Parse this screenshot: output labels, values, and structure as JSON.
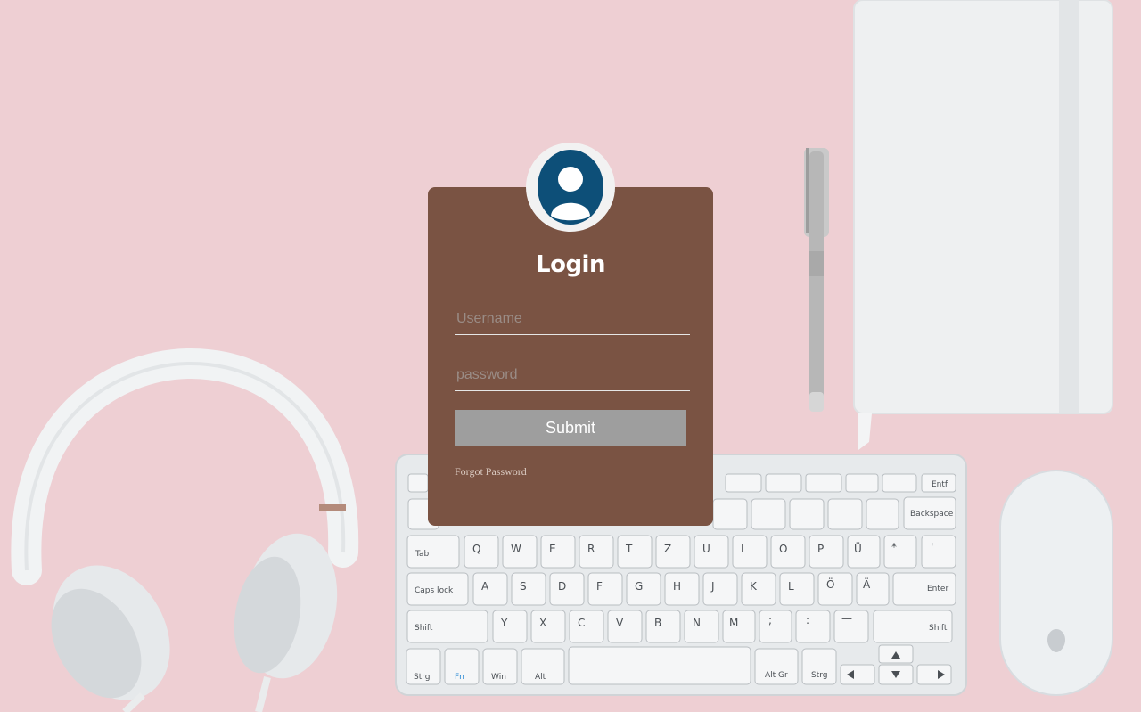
{
  "login": {
    "title": "Login",
    "username_placeholder": "Username",
    "password_placeholder": "password",
    "submit_label": "Submit",
    "forgot_label": "Forgot Password"
  },
  "keyboard": {
    "row1": [
      "Entf"
    ],
    "row2": [
      "Backspace"
    ],
    "row3": [
      "Tab",
      "Q",
      "W",
      "E",
      "R",
      "T",
      "Z",
      "U",
      "I",
      "O",
      "P",
      "Ü",
      "*",
      "'"
    ],
    "row4": [
      "Caps lock",
      "A",
      "S",
      "D",
      "F",
      "G",
      "H",
      "J",
      "K",
      "L",
      "Ö",
      "Ä",
      "Enter"
    ],
    "row5": [
      "Shift",
      "Y",
      "X",
      "C",
      "V",
      "B",
      "N",
      "M",
      ";",
      ":",
      "—",
      "Shift"
    ],
    "row6": [
      "Strg",
      "Fn",
      "Win",
      "Alt",
      "Alt Gr",
      "Strg"
    ]
  },
  "colors": {
    "background": "#eecfd3",
    "card": "#7a5343",
    "avatar_icon": "#0d4f78",
    "submit": "#9e9e9e"
  },
  "icons": {
    "avatar": "user-avatar-icon"
  }
}
